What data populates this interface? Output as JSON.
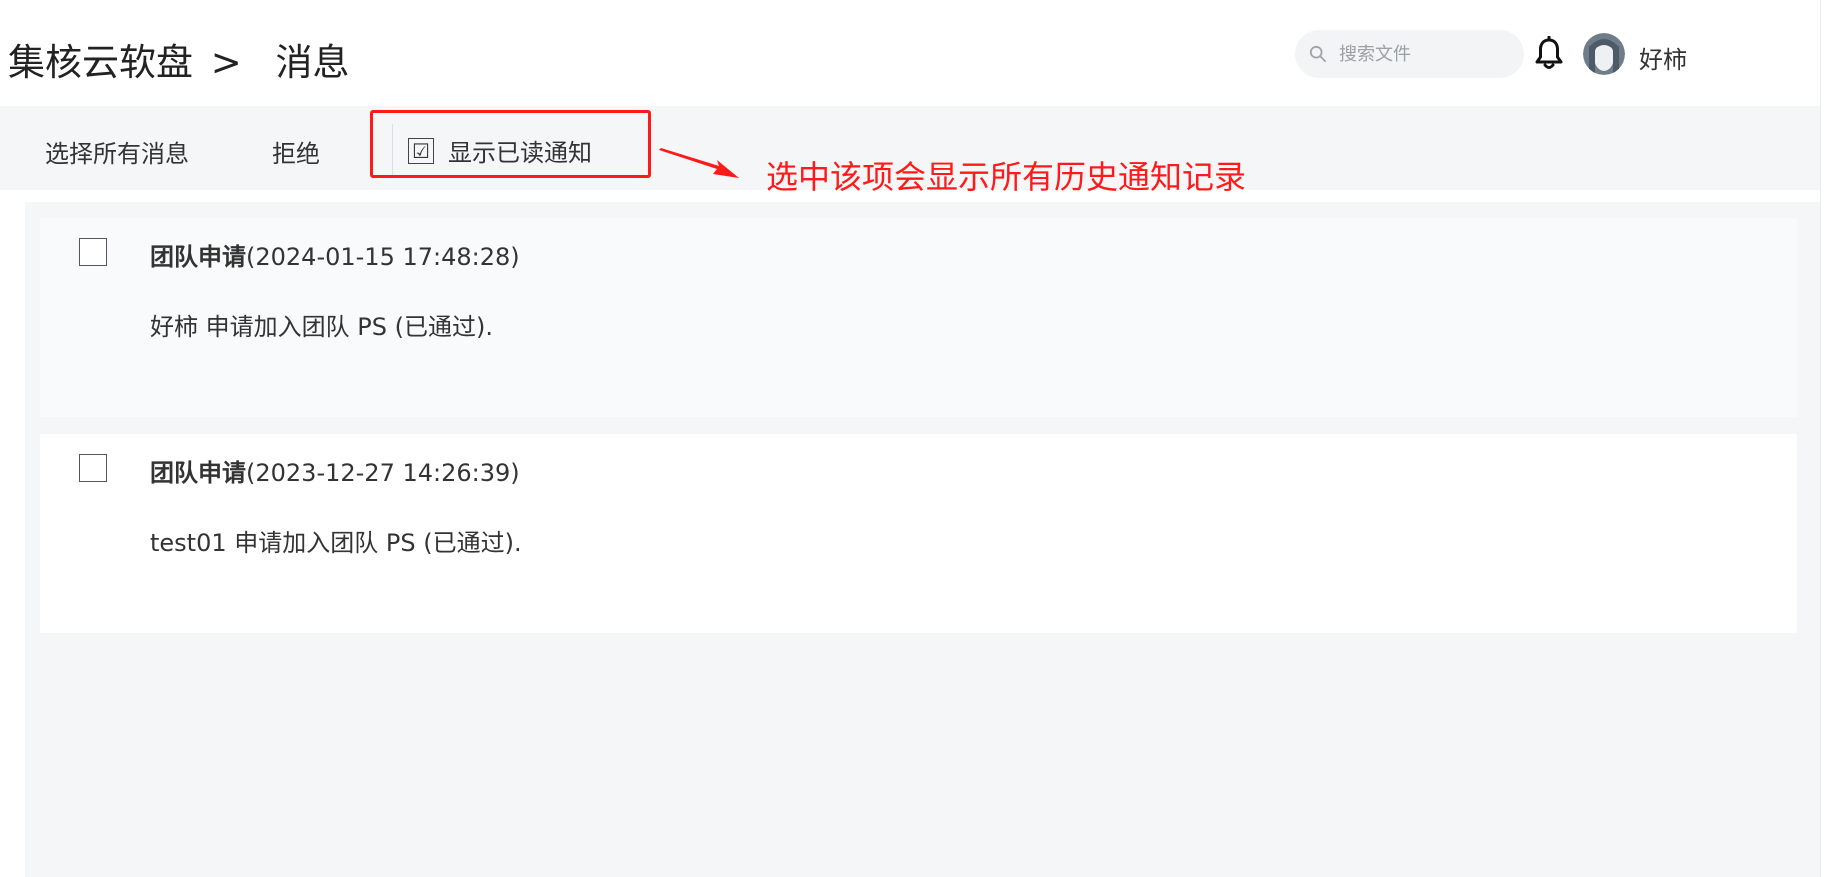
{
  "header": {
    "brand": "集核云软盘",
    "separator": ">",
    "page_title": "消息",
    "search_placeholder": "搜索文件",
    "username": "好柿"
  },
  "toolbar": {
    "select_all_label": "选择所有消息",
    "reject_label": "拒绝",
    "show_read_label": "显示已读通知",
    "show_read_checked": "☑"
  },
  "annotation": {
    "note": "选中该项会显示所有历史通知记录",
    "color": "#ff1a1a"
  },
  "messages": [
    {
      "type": "团队申请",
      "time": "(2024-01-15 17:48:28)",
      "body": "好柿 申请加入团队 PS (已通过)."
    },
    {
      "type": "团队申请",
      "time": "(2023-12-27 14:26:39)",
      "body": "test01 申请加入团队 PS (已通过)."
    }
  ]
}
